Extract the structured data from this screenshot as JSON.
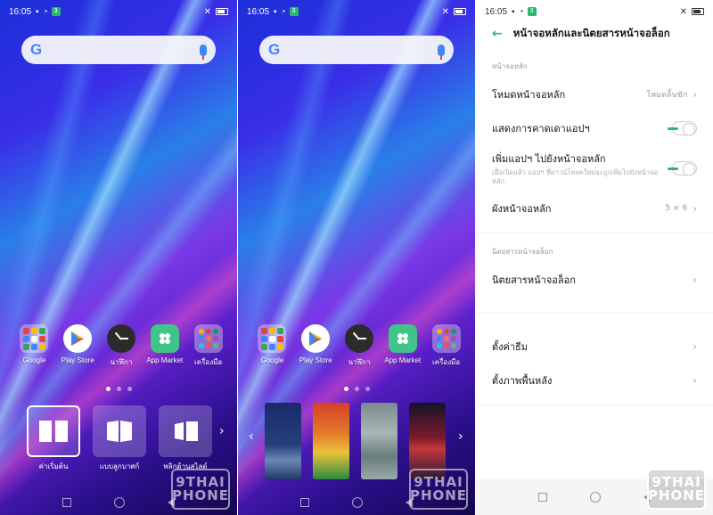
{
  "status_bar": {
    "time": "16:05",
    "sim_badge": "3"
  },
  "home": {
    "apps": [
      {
        "label": "Google"
      },
      {
        "label": "Play Store"
      },
      {
        "label": "นาฬิกา"
      },
      {
        "label": "App Market"
      },
      {
        "label": "เครื่องมือ"
      }
    ],
    "effects": [
      {
        "label": "ค่าเริ่มต้น"
      },
      {
        "label": "แบบลูกบาศก์"
      },
      {
        "label": "พลิกด้านสไลด์"
      }
    ]
  },
  "watermark": {
    "line1": "9THAI",
    "line2": "PHONE"
  },
  "settings": {
    "title": "หน้าจอหลักและนิตยสารหน้าจอล็อก",
    "section_home": "หน้าจอหลัก",
    "home_mode": {
      "label": "โหมดหน้าจอหลัก",
      "value": "โหมดลิ้นชัก"
    },
    "show_suggestions": {
      "label": "แสดงการคาดเดาแอปฯ"
    },
    "add_apps": {
      "label": "เพิ่มแอปฯ ไปยังหน้าจอหลัก",
      "sub": "เมื่อเปิดแล้ว แอปฯ ที่ดาวน์โหลดใหม่จะถูกเพิ่มไปยังหน้าจอหลัก"
    },
    "layout": {
      "label": "ผังหน้าจอหลัก",
      "value": "5 × 6"
    },
    "section_lock": "นิตยสารหน้าจอล็อก",
    "lock_magazine": {
      "label": "นิตยสารหน้าจอล็อก"
    },
    "theme": {
      "label": "ตั้งค่าธีม"
    },
    "wallpaper": {
      "label": "ตั้งภาพพื้นหลัง"
    }
  },
  "colors": {
    "accent": "#2bb673"
  }
}
